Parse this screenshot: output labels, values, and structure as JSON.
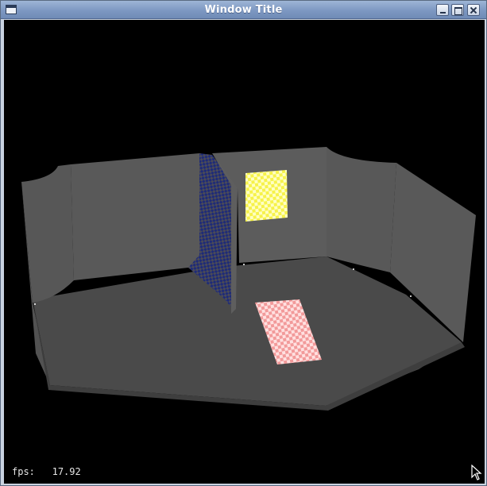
{
  "window": {
    "title": "Window Title",
    "buttons": {
      "minimize": "minimize-icon",
      "maximize": "maximize-icon",
      "close": "close-icon"
    }
  },
  "scene": {
    "description_colors": {
      "wall": "#555555",
      "wall_dark": "#484848",
      "floor": "#4b4b4b",
      "yellow_texture": "#f2ee3a",
      "pink_texture": "#f08c8c",
      "blue_texture": "#23307a"
    }
  },
  "overlay": {
    "fps_label": "fps:",
    "fps_value": "17.92"
  }
}
